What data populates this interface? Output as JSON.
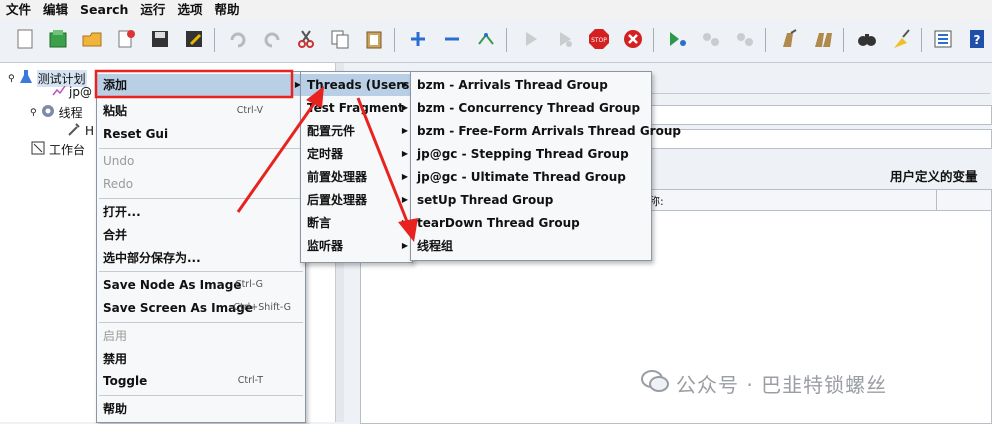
{
  "menubar": [
    "文件",
    "编辑",
    "Search",
    "运行",
    "选项",
    "帮助"
  ],
  "tree": {
    "test_plan": "测试计划",
    "jp_item": "jp@",
    "thread_group": "线程",
    "sampler": "H",
    "workbench": "工作台"
  },
  "right": {
    "user_vars": "用户定义的变量",
    "col_name": "称:"
  },
  "context_menu": {
    "add": "添加",
    "paste": "粘贴",
    "paste_acc": "Ctrl-V",
    "reset_gui": "Reset Gui",
    "undo": "Undo",
    "redo": "Redo",
    "open": "打开...",
    "merge": "合并",
    "save_selection": "选中部分保存为...",
    "save_node_image": "Save Node As Image",
    "save_node_acc": "Ctrl-G",
    "save_screen_image": "Save Screen As Image",
    "save_screen_acc": "Ctrl+Shift-G",
    "enable": "启用",
    "disable": "禁用",
    "toggle": "Toggle",
    "toggle_acc": "Ctrl-T",
    "help": "帮助"
  },
  "add_submenu": [
    "Threads (Users)",
    "Test Fragment",
    "配置元件",
    "定时器",
    "前置处理器",
    "后置处理器",
    "断言",
    "监听器"
  ],
  "threads_submenu": [
    "bzm - Arrivals Thread Group",
    "bzm - Concurrency Thread Group",
    "bzm - Free-Form Arrivals Thread Group",
    "jp@gc - Stepping Thread Group",
    "jp@gc - Ultimate Thread Group",
    "setUp Thread Group",
    "tearDown Thread Group",
    "线程组"
  ],
  "watermark": "公众号 · 巴韭特锁螺丝",
  "colors": {
    "highlight": "#b8cfe6",
    "annotation_red": "#e8231f"
  }
}
